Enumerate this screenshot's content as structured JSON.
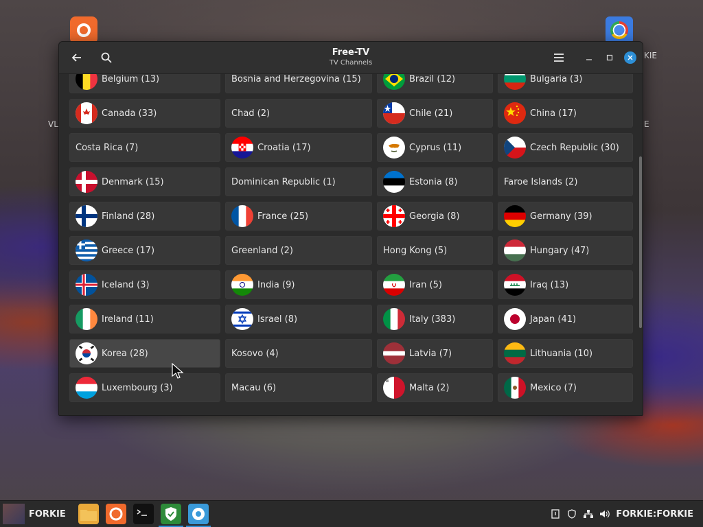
{
  "window": {
    "title": "Free-TV",
    "subtitle": "TV Channels"
  },
  "desktop": {
    "behind_labels": [
      "VL",
      "E",
      "KIE"
    ]
  },
  "countries": [
    {
      "label": "Belgium (13)",
      "flag": "be"
    },
    {
      "label": "Bosnia and Herzegovina (15)",
      "flag": null
    },
    {
      "label": "Brazil (12)",
      "flag": "br"
    },
    {
      "label": "Bulgaria (3)",
      "flag": "bg"
    },
    {
      "label": "Canada (33)",
      "flag": "ca"
    },
    {
      "label": "Chad (2)",
      "flag": null
    },
    {
      "label": "Chile (21)",
      "flag": "cl"
    },
    {
      "label": "China (17)",
      "flag": "cn"
    },
    {
      "label": "Costa Rica (7)",
      "flag": null
    },
    {
      "label": "Croatia (17)",
      "flag": "hr"
    },
    {
      "label": "Cyprus (11)",
      "flag": "cy"
    },
    {
      "label": "Czech Republic (30)",
      "flag": "cz"
    },
    {
      "label": "Denmark (15)",
      "flag": "dk"
    },
    {
      "label": "Dominican Republic (1)",
      "flag": null
    },
    {
      "label": "Estonia (8)",
      "flag": "ee"
    },
    {
      "label": "Faroe Islands (2)",
      "flag": null
    },
    {
      "label": "Finland (28)",
      "flag": "fi"
    },
    {
      "label": "France (25)",
      "flag": "fr"
    },
    {
      "label": "Georgia (8)",
      "flag": "ge"
    },
    {
      "label": "Germany (39)",
      "flag": "de"
    },
    {
      "label": "Greece (17)",
      "flag": "gr"
    },
    {
      "label": "Greenland (2)",
      "flag": null
    },
    {
      "label": "Hong Kong (5)",
      "flag": null
    },
    {
      "label": "Hungary (47)",
      "flag": "hu"
    },
    {
      "label": "Iceland (3)",
      "flag": "is"
    },
    {
      "label": "India (9)",
      "flag": "in"
    },
    {
      "label": "Iran (5)",
      "flag": "ir"
    },
    {
      "label": "Iraq (13)",
      "flag": "iq"
    },
    {
      "label": "Ireland (11)",
      "flag": "ie"
    },
    {
      "label": "Israel (8)",
      "flag": "il"
    },
    {
      "label": "Italy (383)",
      "flag": "it"
    },
    {
      "label": "Japan (41)",
      "flag": "jp"
    },
    {
      "label": "Korea (28)",
      "flag": "kr"
    },
    {
      "label": "Kosovo (4)",
      "flag": null
    },
    {
      "label": "Latvia (7)",
      "flag": "lv"
    },
    {
      "label": "Lithuania (10)",
      "flag": "lt"
    },
    {
      "label": "Luxembourg (3)",
      "flag": "lu"
    },
    {
      "label": "Macau (6)",
      "flag": null
    },
    {
      "label": "Malta (2)",
      "flag": "mt"
    },
    {
      "label": "Mexico (7)",
      "flag": "mx"
    }
  ],
  "hovered_country": "Korea (28)",
  "taskbar": {
    "user_label": "FORKIE",
    "apps": [
      "files-icon",
      "firefox-icon",
      "terminal-icon",
      "shield-icon",
      "freetv-icon"
    ],
    "tray_user": "FORKIE:FORKIE"
  },
  "colors": {
    "accent": "#2d8fd6",
    "window_bg": "#2b2b2b",
    "cell_bg": "#373737"
  }
}
